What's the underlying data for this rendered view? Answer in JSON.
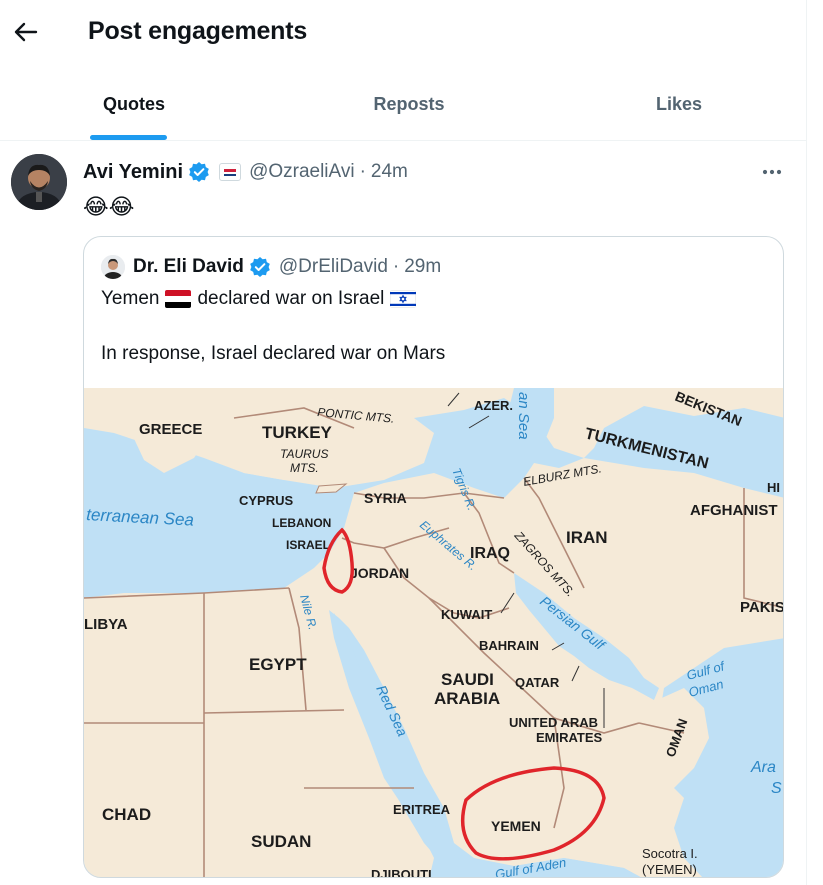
{
  "header": {
    "title": "Post engagements",
    "back_icon": "arrow-left-icon"
  },
  "tabs": [
    {
      "label": "Quotes",
      "active": true
    },
    {
      "label": "Reposts",
      "active": false
    },
    {
      "label": "Likes",
      "active": false
    }
  ],
  "post": {
    "author_name": "Avi Yemini",
    "handle": "@OzraeliAvi",
    "separator": "·",
    "time": "24m",
    "text": "😂😂",
    "more_icon": "more-horizontal-icon",
    "verified_icon": "verified-badge-icon",
    "affiliation_icon": "rebel-news-badge-icon",
    "quoted": {
      "author_name": "Dr. Eli David",
      "handle": "@DrEliDavid",
      "separator": "·",
      "time": "29m",
      "line1_a": "Yemen",
      "line1_b": "declared war on Israel",
      "line2": "In response, Israel declared war on Mars",
      "flag_1": "yemen-flag-icon",
      "flag_2": "israel-flag-icon"
    }
  },
  "map": {
    "labels": {
      "greece": "GREECE",
      "turkey": "TURKEY",
      "pontic": "PONTIC MTS.",
      "taurus1": "TAURUS",
      "taurus2": "MTS.",
      "azer": "AZER.",
      "caspian": "an Sea",
      "turkmenistan": "TURKMENISTAN",
      "uzbekistan": "BEKISTAN",
      "elburz": "ELBURZ MTS.",
      "hi": "HI",
      "cyprus": "CYPRUS",
      "syria": "SYRIA",
      "tigris": "Tigris R.",
      "med": "terranean Sea",
      "lebanon": "LEBANON",
      "israel": "ISRAEL",
      "euphrates": "Euphrates R.",
      "iraq": "IRAQ",
      "zagros": "ZAGROS MTS.",
      "iran": "IRAN",
      "afghanistan": "AFGHANIST",
      "jordan": "JORDAN",
      "nile": "Nile R.",
      "kuwait": "KUWAIT",
      "persian": "Persian Gulf",
      "pakistan": "PAKIS",
      "libya": "LIBYA",
      "bahrain": "BAHRAIN",
      "egypt": "EGYPT",
      "saudi1": "SAUDI",
      "saudi2": "ARABIA",
      "qatar": "QATAR",
      "oman_gulf1": "Gulf of",
      "oman_gulf2": "Oman",
      "red_sea": "Red Sea",
      "uae1": "UNITED ARAB",
      "uae2": "EMIRATES",
      "oman": "OMAN",
      "arabian1": "Ara",
      "arabian2": "S",
      "chad": "CHAD",
      "eritrea": "ERITREA",
      "yemen": "YEMEN",
      "sudan": "SUDAN",
      "aden": "Gulf of Aden",
      "socotra1": "Socotra I.",
      "socotra2": "(YEMEN)",
      "djibouti": "DJIBOUTI"
    },
    "colors": {
      "water": "#bfe0f5",
      "land": "#f5ead8",
      "border": "#b28a78",
      "water_label": "#2b86c5",
      "circle": "#e0252b"
    }
  }
}
